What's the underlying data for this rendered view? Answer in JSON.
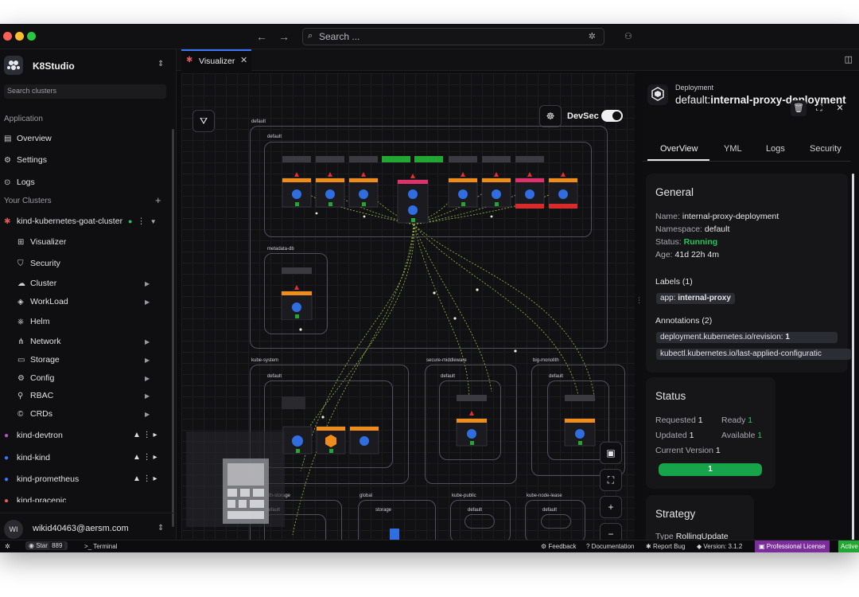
{
  "titlebar": {
    "search_placeholder": "Search ...",
    "back": "←",
    "forward": "→"
  },
  "sidebar": {
    "app_name": "K8Studio",
    "search_placeholder": "Search clusters",
    "application_label": "Application",
    "app_items": [
      {
        "label": "Overview",
        "icon": "server-icon"
      },
      {
        "label": "Settings",
        "icon": "gear-icon"
      },
      {
        "label": "Logs",
        "icon": "logs-icon"
      }
    ],
    "clusters_label": "Your Clusters",
    "active_cluster": "kind-kubernetes-goat-cluster",
    "cluster_items": [
      {
        "label": "Visualizer"
      },
      {
        "label": "Security"
      },
      {
        "label": "Cluster"
      },
      {
        "label": "WorkLoad"
      },
      {
        "label": "Helm"
      },
      {
        "label": "Network"
      },
      {
        "label": "Storage"
      },
      {
        "label": "Config"
      },
      {
        "label": "RBAC"
      },
      {
        "label": "CRDs"
      }
    ],
    "other_clusters": [
      "kind-devtron",
      "kind-kind",
      "kind-prometheus",
      "kind-pracenic"
    ],
    "user_initials": "WI",
    "user_email": "wikid40463@aersm.com"
  },
  "tabs": [
    {
      "label": "Visualizer"
    }
  ],
  "canvas": {
    "devsec_label": "DevSec",
    "namespaces": [
      {
        "label": "default"
      },
      {
        "label": "default"
      },
      {
        "label": "metadata-db"
      },
      {
        "label": "kube-system"
      },
      {
        "label": "default"
      },
      {
        "label": "secure-middleware"
      },
      {
        "label": "default"
      },
      {
        "label": "big-monolith"
      },
      {
        "label": "default"
      },
      {
        "label": "th-storage"
      },
      {
        "label": "default"
      },
      {
        "label": "global"
      },
      {
        "label": "storage"
      },
      {
        "label": "kube-public"
      },
      {
        "label": "default"
      },
      {
        "label": "kube-node-lease"
      },
      {
        "label": "default"
      }
    ]
  },
  "panel": {
    "kind": "Deployment",
    "title_ns": "default:",
    "title_name": "internal-proxy-deployment",
    "tabs": [
      "OverView",
      "YML",
      "Logs",
      "Security"
    ],
    "general": {
      "heading": "General",
      "name_label": "Name:",
      "name": "internal-proxy-deployment",
      "namespace_label": "Namespace:",
      "namespace": "default",
      "status_label": "Status:",
      "status": "Running",
      "age_label": "Age:",
      "age": "41d 22h 4m",
      "labels_heading": "Labels (1)",
      "label_key": "app:",
      "label_value": "internal-proxy",
      "annotations_heading": "Annotations (2)",
      "annotation1_key": "deployment.kubernetes.io/revision:",
      "annotation1_value": "1",
      "annotation2": "kubectl.kubernetes.io/last-applied-configuratic"
    },
    "status": {
      "heading": "Status",
      "requested_label": "Requested",
      "requested": "1",
      "ready_label": "Ready",
      "ready": "1",
      "updated_label": "Updated",
      "updated": "1",
      "available_label": "Available",
      "available": "1",
      "version_label": "Current Version",
      "version": "1",
      "bar_value": "1"
    },
    "strategy": {
      "heading": "Strategy",
      "type_label": "Type",
      "type": "RollingUpdate"
    }
  },
  "statusbar": {
    "star_label": "Star",
    "star_count": "889",
    "terminal": "Terminal",
    "feedback": "Feedback",
    "documentation": "Documentation",
    "report_bug": "Report Bug",
    "version": "Version: 3.1.2",
    "license": "Professional License",
    "active": "Active"
  },
  "colors": {
    "accent": "#3a76ff",
    "running": "#22c55e",
    "bar": "#16a34a",
    "license": "#7c2d9c",
    "active": "#22a832"
  }
}
